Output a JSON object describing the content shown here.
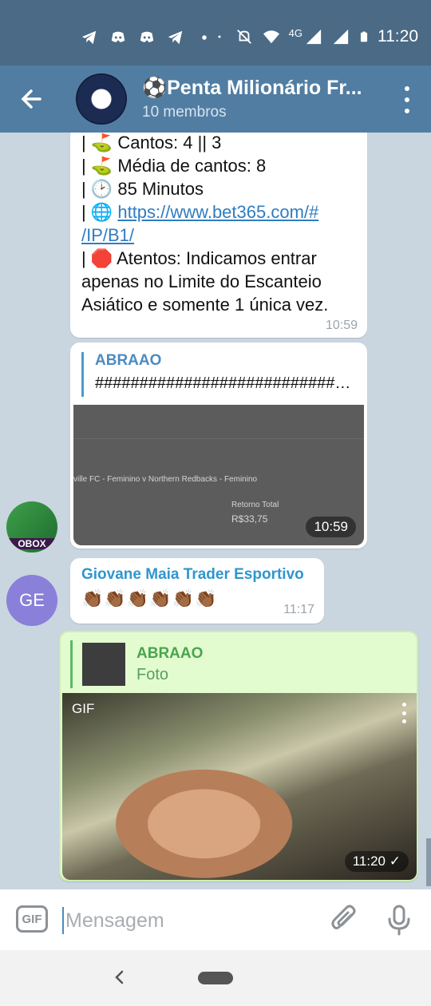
{
  "status": {
    "time": "11:20",
    "network": "4G",
    "notification_icons": [
      "telegram-icon",
      "discord-icon",
      "discord-icon",
      "telegram-icon",
      "dot-icon"
    ],
    "system_icons": [
      "dot-icon",
      "mute-icon",
      "wifi-icon",
      "signal-icon",
      "signal-icon",
      "battery-icon"
    ]
  },
  "header": {
    "title": "⚽Penta Milionário Fr...",
    "subtitle": "10 membros"
  },
  "messages": {
    "m1": {
      "lines": [
        "| ⛳ Cantos: 4 || 3",
        "| ⛳ Média de cantos: 8",
        "| 🕑 85 Minutos"
      ],
      "link_prefix": "| 🌐 ",
      "link_line1": "https://www.bet365.com/#",
      "link_line2": "/IP/B1/",
      "warning_line1": "| 🛑 Atentos: Indicamos entrar",
      "warning_line2": "apenas no Limite do Escanteio",
      "warning_line3": "Asiático e somente 1 única vez.",
      "time": "10:59"
    },
    "m2": {
      "reply_name": "ABRAAO",
      "reply_text": "########################################",
      "image_caption": "ville FC - Feminino v Northern Redbacks - Feminino",
      "image_label": "Retorno Total",
      "image_value": "R$33,75",
      "time": "10:59",
      "avatar_label": "OBOX"
    },
    "m3": {
      "avatar_initials": "GE",
      "sender": "Giovane Maia Trader Esportivo",
      "text": "👏🏾👏🏾👏🏾👏🏾👏🏾👏🏾",
      "time": "11:17"
    },
    "m4": {
      "reply_name": "ABRAAO",
      "reply_text": "Foto",
      "gif_tag": "GIF",
      "time": "11:20",
      "status": "✓"
    }
  },
  "composer": {
    "gif_label": "GIF",
    "placeholder": "Mensagem"
  }
}
